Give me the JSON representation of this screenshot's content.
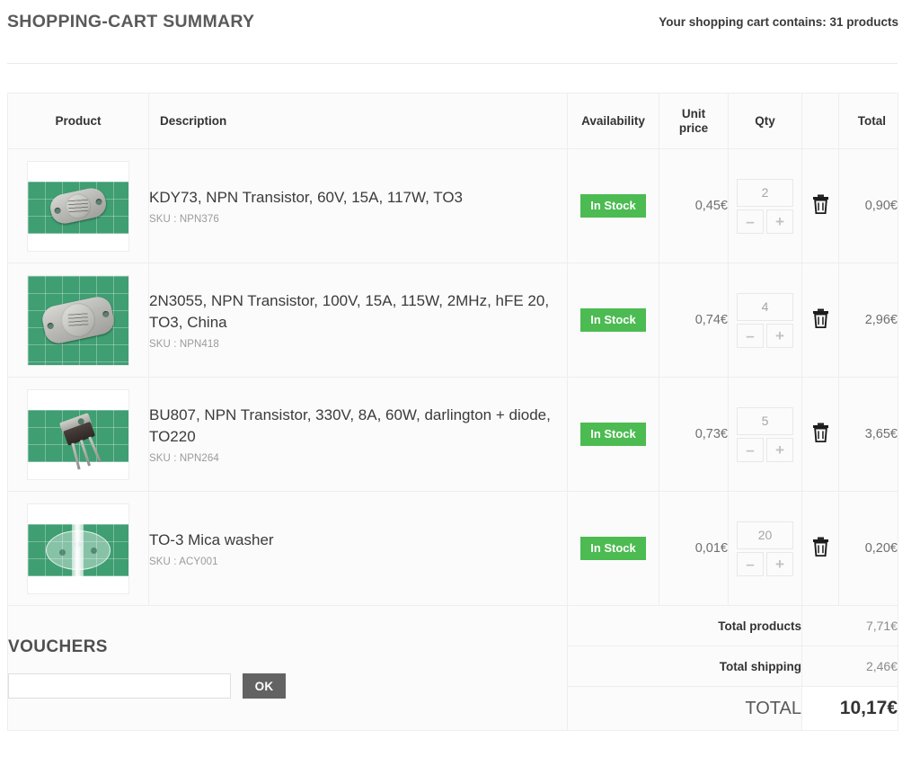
{
  "header": {
    "title": "SHOPPING-CART SUMMARY",
    "cart_count_text": "Your shopping cart contains: 31 products"
  },
  "table": {
    "columns": {
      "product": "Product",
      "description": "Description",
      "availability": "Availability",
      "unit_price_line1": "Unit",
      "unit_price_line2": "price",
      "qty": "Qty",
      "blank": "",
      "total": "Total"
    },
    "rows": [
      {
        "image": "to3-metal-transistor-on-green-cutting-mat",
        "name": "KDY73, NPN Transistor, 60V, 15A, 117W, TO3",
        "sku": "SKU : NPN376",
        "availability": "In Stock",
        "unit_price": "0,45€",
        "qty": "2",
        "minus": "–",
        "plus": "+",
        "total": "0,90€"
      },
      {
        "image": "to3-metal-transistor-closeup-on-green-cutting-mat",
        "name": "2N3055, NPN Transistor, 100V, 15A, 115W, 2MHz, hFE 20, TO3, China",
        "sku": "SKU : NPN418",
        "availability": "In Stock",
        "unit_price": "0,74€",
        "qty": "4",
        "minus": "–",
        "plus": "+",
        "total": "2,96€"
      },
      {
        "image": "to220-plastic-transistor-on-green-cutting-mat",
        "name": "BU807, NPN Transistor, 330V, 8A, 60W, darlington + diode, TO220",
        "sku": "SKU : NPN264",
        "availability": "In Stock",
        "unit_price": "0,73€",
        "qty": "5",
        "minus": "–",
        "plus": "+",
        "total": "3,65€"
      },
      {
        "image": "to3-mica-washer-on-green-cutting-mat",
        "name": "TO-3 Mica washer",
        "sku": "SKU : ACY001",
        "availability": "In Stock",
        "unit_price": "0,01€",
        "qty": "20",
        "minus": "–",
        "plus": "+",
        "total": "0,20€"
      }
    ]
  },
  "vouchers": {
    "title": "VOUCHERS",
    "input_value": "",
    "input_placeholder": "",
    "ok_label": "OK"
  },
  "summary": {
    "total_products_label": "Total products",
    "total_products_value": "7,71€",
    "total_shipping_label": "Total shipping",
    "total_shipping_value": "2,46€",
    "grand_total_label": "TOTAL",
    "grand_total_value": "10,17€"
  },
  "colors": {
    "in_stock_badge": "#4cbb52",
    "ok_button": "#636363",
    "border": "#eeeeee",
    "row_background": "#fbfbfb"
  },
  "icons": {
    "delete": "trash-icon"
  }
}
